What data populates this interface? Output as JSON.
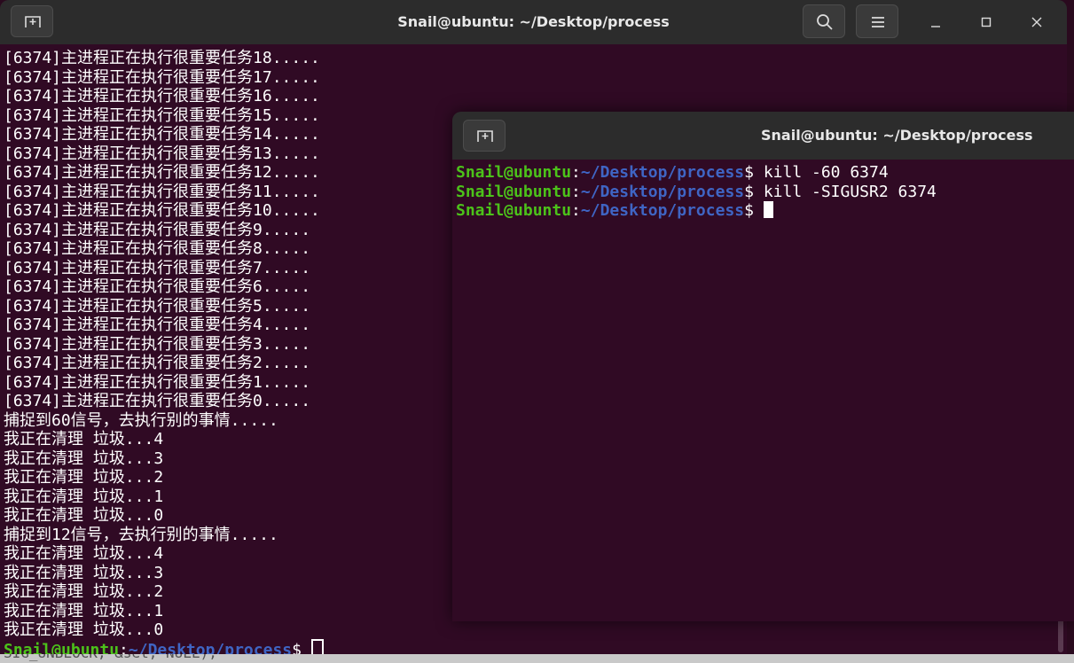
{
  "back_window": {
    "title": "Snail@ubuntu: ~/Desktop/process",
    "lines": [
      "[6374]主进程正在执行很重要任务18.....",
      "[6374]主进程正在执行很重要任务17.....",
      "[6374]主进程正在执行很重要任务16.....",
      "[6374]主进程正在执行很重要任务15.....",
      "[6374]主进程正在执行很重要任务14.....",
      "[6374]主进程正在执行很重要任务13.....",
      "[6374]主进程正在执行很重要任务12.....",
      "[6374]主进程正在执行很重要任务11.....",
      "[6374]主进程正在执行很重要任务10.....",
      "[6374]主进程正在执行很重要任务9.....",
      "[6374]主进程正在执行很重要任务8.....",
      "[6374]主进程正在执行很重要任务7.....",
      "[6374]主进程正在执行很重要任务6.....",
      "[6374]主进程正在执行很重要任务5.....",
      "[6374]主进程正在执行很重要任务4.....",
      "[6374]主进程正在执行很重要任务3.....",
      "[6374]主进程正在执行很重要任务2.....",
      "[6374]主进程正在执行很重要任务1.....",
      "[6374]主进程正在执行很重要任务0.....",
      "捕捉到60信号，去执行别的事情.....",
      "我正在清理 垃圾...4",
      "我正在清理 垃圾...3",
      "我正在清理 垃圾...2",
      "我正在清理 垃圾...1",
      "我正在清理 垃圾...0",
      "捕捉到12信号，去执行别的事情.....",
      "我正在清理 垃圾...4",
      "我正在清理 垃圾...3",
      "我正在清理 垃圾...2",
      "我正在清理 垃圾...1",
      "我正在清理 垃圾...0"
    ],
    "prompt": {
      "user": "Snail@ubuntu",
      "sep": ":",
      "dir": "~/Desktop/process",
      "symbol": "$ "
    },
    "partial_line": "SIG_UNBLOCK, &set, NULL);"
  },
  "front_window": {
    "title": "Snail@ubuntu: ~/Desktop/process",
    "prompt": {
      "user": "Snail@ubuntu",
      "sep": ":",
      "dir": "~/Desktop/process",
      "symbol": "$ "
    },
    "commands": [
      "kill -60 6374",
      "kill -SIGUSR2 6374",
      ""
    ]
  },
  "icons": {
    "new_tab": "new-tab-icon",
    "search": "search-icon",
    "menu": "hamburger-menu-icon",
    "minimize": "minimize-icon",
    "maximize": "maximize-icon",
    "close": "close-icon"
  },
  "colors": {
    "terminal_bg": "#300a24",
    "titlebar_bg": "#2c2c2c",
    "prompt_user": "#4cc21a",
    "prompt_dir": "#3f65c4",
    "text": "#ffffff"
  }
}
